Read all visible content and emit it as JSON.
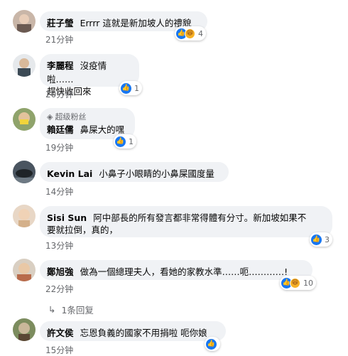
{
  "comments": [
    {
      "name": "莊子瑩",
      "text": "Errrr 這就是新加坡人的禮貌",
      "time": "21分钟",
      "reactions": "4"
    },
    {
      "name": "李麗程",
      "text_line1": "沒疫情啦……",
      "text_line2": "趕快收回來",
      "time": "20分钟",
      "reactions": "1"
    },
    {
      "badge": "超级粉丝",
      "name": "賴廷儒",
      "text": "鼻屎大的嘿",
      "time": "19分钟",
      "reactions": "1"
    },
    {
      "name": "Kevin Lai",
      "text": "小鼻子小眼睛的小鼻屎國度量",
      "time": "14分钟"
    },
    {
      "name": "Sisi Sun",
      "text_line1": "阿中部長的所有發言都非常得體有分寸。新加坡如果不",
      "text_line2": "要就拉倒，真的，",
      "time": "13分钟",
      "reactions": "3"
    },
    {
      "name": "鄭旭強",
      "text": "做為一個總理夫人，看她的家教水準……呃…………!",
      "time": "22分钟",
      "reactions": "10"
    },
    {
      "name": "許文侯",
      "text": "忘恩負義的國家不用捐啦 呃你娘",
      "time": "15分钟"
    }
  ],
  "replies_link": "1条回复",
  "colors": {
    "like": "#1877f2",
    "haha": "#f7b125",
    "bubble": "#f0f2f5",
    "meta": "#65676b"
  }
}
